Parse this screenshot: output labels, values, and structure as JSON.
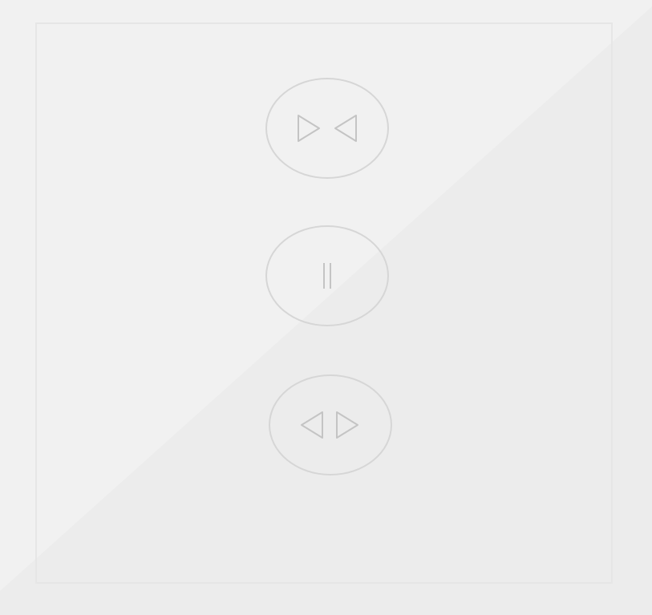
{
  "controls": {
    "close_icon": "curtain-close-icon",
    "pause_icon": "pause-icon",
    "open_icon": "curtain-open-icon"
  },
  "colors": {
    "background": "#f1f1f1",
    "lower_triangle": "#ececec",
    "panel_border": "#e6e6e6",
    "button_border": "#d6d6d6",
    "icon_stroke": "#c4c4c4"
  }
}
